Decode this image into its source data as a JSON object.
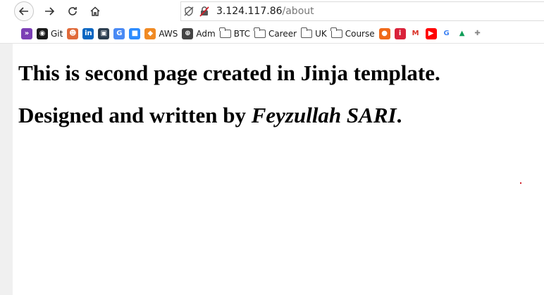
{
  "browser": {
    "url_host": "3.124.117.86",
    "url_path": "/about"
  },
  "bookmarks": [
    {
      "name": "arrow-app-icon",
      "label": "",
      "color": "#7b3fb5",
      "glyph": "»",
      "type": "icon"
    },
    {
      "name": "github-icon",
      "label": "Git",
      "color": "#1a1a1a",
      "glyph": "◉",
      "type": "icon"
    },
    {
      "name": "avatar-icon",
      "label": "",
      "color": "#e06a3a",
      "glyph": "☻",
      "type": "icon"
    },
    {
      "name": "linkedin-icon",
      "label": "",
      "color": "#0a66c2",
      "glyph": "in",
      "type": "icon"
    },
    {
      "name": "lock-app-icon",
      "label": "",
      "color": "#2c3e50",
      "glyph": "▣",
      "type": "icon"
    },
    {
      "name": "translate-icon",
      "label": "",
      "color": "#4a8af4",
      "glyph": "G",
      "type": "icon"
    },
    {
      "name": "zoom-icon",
      "label": "",
      "color": "#2d8cff",
      "glyph": "■",
      "type": "icon"
    },
    {
      "name": "aws-icon",
      "label": "AWS",
      "color": "#f08a24",
      "glyph": "◆",
      "type": "icon"
    },
    {
      "name": "globe-icon",
      "label": "Adm",
      "color": "#444444",
      "glyph": "⊕",
      "type": "icon"
    },
    {
      "name": "folder-icon",
      "label": "BTC",
      "type": "folder"
    },
    {
      "name": "folder-icon",
      "label": "Career",
      "type": "folder"
    },
    {
      "name": "folder-icon",
      "label": "UK",
      "type": "folder"
    },
    {
      "name": "folder-icon",
      "label": "Course",
      "type": "folder"
    },
    {
      "name": "orange-circle-icon",
      "label": "",
      "color": "#f06a1a",
      "glyph": "●",
      "type": "icon"
    },
    {
      "name": "red-app-icon",
      "label": "",
      "color": "#d9223a",
      "glyph": "i",
      "type": "icon"
    },
    {
      "name": "gmail-icon",
      "label": "",
      "color": "#ffffff",
      "glyph": "M",
      "type": "icon",
      "fg": "#d93025"
    },
    {
      "name": "youtube-icon",
      "label": "",
      "color": "#ff0000",
      "glyph": "▶",
      "type": "icon"
    },
    {
      "name": "google-icon",
      "label": "",
      "color": "#ffffff",
      "glyph": "G",
      "type": "icon",
      "fg": "#4285f4"
    },
    {
      "name": "drive-icon",
      "label": "",
      "color": "#ffffff",
      "glyph": "▲",
      "type": "icon",
      "fg": "#0f9d58"
    },
    {
      "name": "puzzle-icon",
      "label": "",
      "color": "#ffffff",
      "glyph": "✚",
      "type": "icon",
      "fg": "#888888"
    }
  ],
  "page": {
    "heading1": "This is second page created in Jinja template.",
    "heading2_prefix": "Designed and written by ",
    "heading2_name": "Feyzullah SARI",
    "heading2_suffix": "."
  }
}
